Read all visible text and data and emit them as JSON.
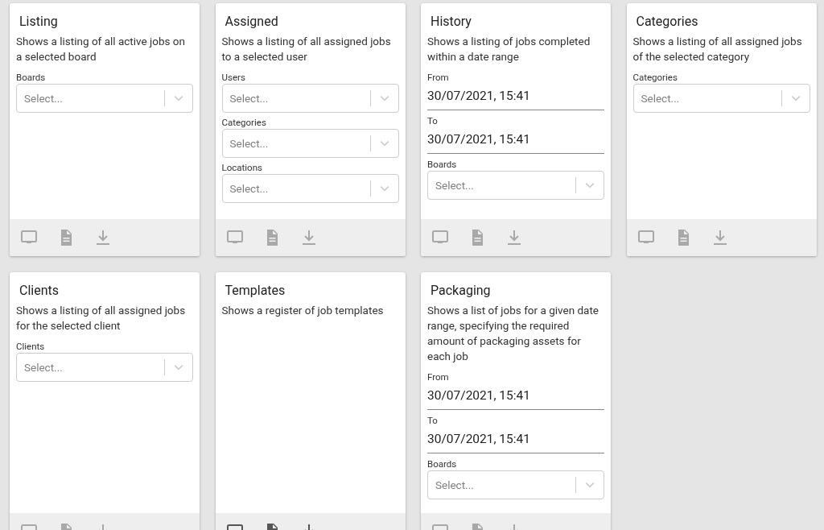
{
  "cards": [
    {
      "title": "Listing",
      "description": "Shows a listing of all active jobs on a selected board",
      "actions_disabled": true,
      "fields": [
        {
          "kind": "select",
          "label": "Boards",
          "placeholder": "Select..."
        }
      ]
    },
    {
      "title": "Assigned",
      "description": "Shows a listing of all assigned jobs to a selected user",
      "actions_disabled": true,
      "fields": [
        {
          "kind": "select",
          "label": "Users",
          "placeholder": "Select..."
        },
        {
          "kind": "select",
          "label": "Categories",
          "placeholder": "Select..."
        },
        {
          "kind": "select",
          "label": "Locations",
          "placeholder": "Select..."
        }
      ]
    },
    {
      "title": "History",
      "description": "Shows a listing of jobs completed within a date range",
      "actions_disabled": true,
      "fields": [
        {
          "kind": "date",
          "label": "From",
          "value": "30/07/2021, 15:41"
        },
        {
          "kind": "date",
          "label": "To",
          "value": "30/07/2021, 15:41"
        },
        {
          "kind": "select",
          "label": "Boards",
          "placeholder": "Select..."
        }
      ]
    },
    {
      "title": "Categories",
      "description": "Shows a listing of all assigned jobs of the selected category",
      "actions_disabled": true,
      "fields": [
        {
          "kind": "select",
          "label": "Categories",
          "placeholder": "Select..."
        }
      ]
    },
    {
      "title": "Clients",
      "description": "Shows a listing of all assigned jobs for the selected client",
      "actions_disabled": true,
      "fields": [
        {
          "kind": "select",
          "label": "Clients",
          "placeholder": "Select..."
        }
      ]
    },
    {
      "title": "Templates",
      "description": "Shows a register of job templates",
      "actions_disabled": false
    },
    {
      "title": "Packaging",
      "description": "Shows a list of jobs for a given date range, specifying the required amount of packaging assets for each job",
      "actions_disabled": true,
      "fields": [
        {
          "kind": "date",
          "label": "From",
          "value": "30/07/2021, 15:41"
        },
        {
          "kind": "date",
          "label": "To",
          "value": "30/07/2021, 15:41"
        },
        {
          "kind": "select",
          "label": "Boards",
          "placeholder": "Select..."
        }
      ]
    }
  ]
}
